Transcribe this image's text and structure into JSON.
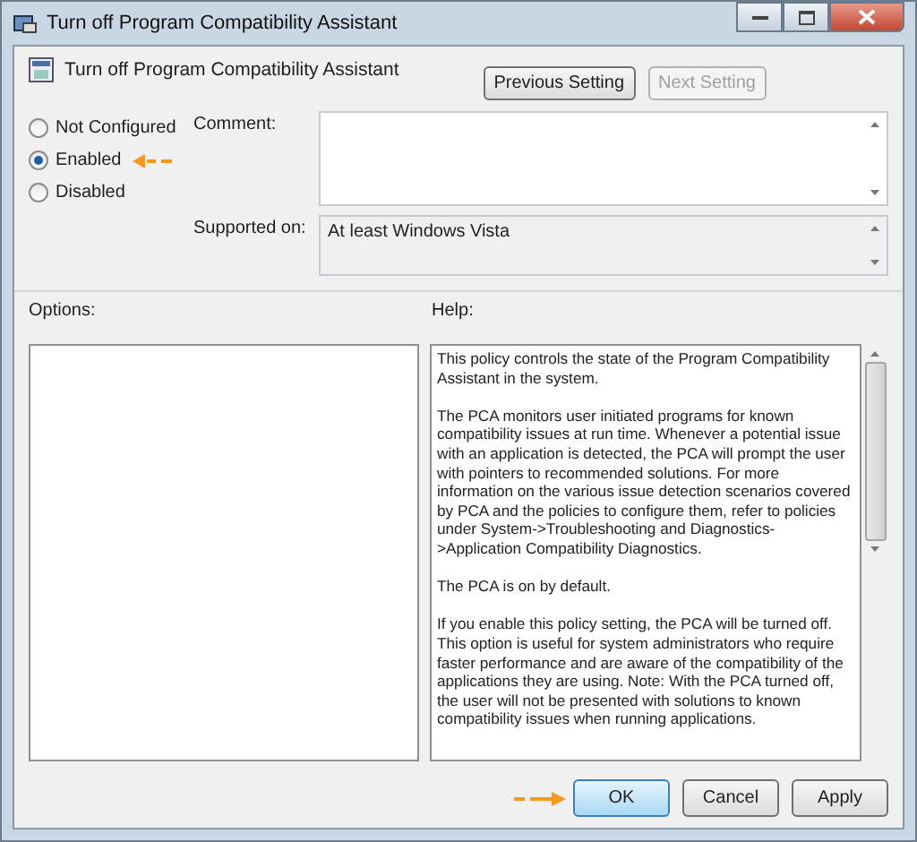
{
  "window": {
    "title": "Turn off Program Compatibility Assistant"
  },
  "header": {
    "title": "Turn off Program Compatibility Assistant",
    "buttons": [
      {
        "label": "Previous Setting",
        "disabled": false
      },
      {
        "label": "Next Setting",
        "disabled": true
      }
    ]
  },
  "state_options": [
    {
      "label": "Not Configured",
      "selected": false
    },
    {
      "label": "Enabled",
      "selected": true
    },
    {
      "label": "Disabled",
      "selected": false
    }
  ],
  "comment": {
    "label": "Comment:"
  },
  "supported_on": {
    "label": "Supported on:",
    "value": "At least Windows Vista"
  },
  "options": {
    "label": "Options:"
  },
  "help": {
    "label": "Help:",
    "paragraphs": [
      "This policy controls the state of the Program Compatibility Assistant in the system.",
      "The PCA monitors user initiated programs for known compatibility issues at run time. Whenever a potential issue with an application is detected, the PCA will prompt the user with pointers to recommended solutions.  For more information on the various issue detection scenarios covered by PCA and the policies to configure them, refer to policies under System->Troubleshooting and Diagnostics->Application Compatibility Diagnostics.",
      "The PCA is on by default.",
      "If you enable this policy setting, the PCA will be turned off. This option is useful for system administrators who require faster performance and are aware of the compatibility of the applications they are using. Note: With the PCA turned off, the user will not be presented with solutions to known compatibility issues when running applications."
    ]
  },
  "footer_buttons": [
    {
      "label": "OK",
      "kind": "default"
    },
    {
      "label": "Cancel",
      "kind": "normal"
    },
    {
      "label": "Apply",
      "kind": "normal"
    }
  ]
}
